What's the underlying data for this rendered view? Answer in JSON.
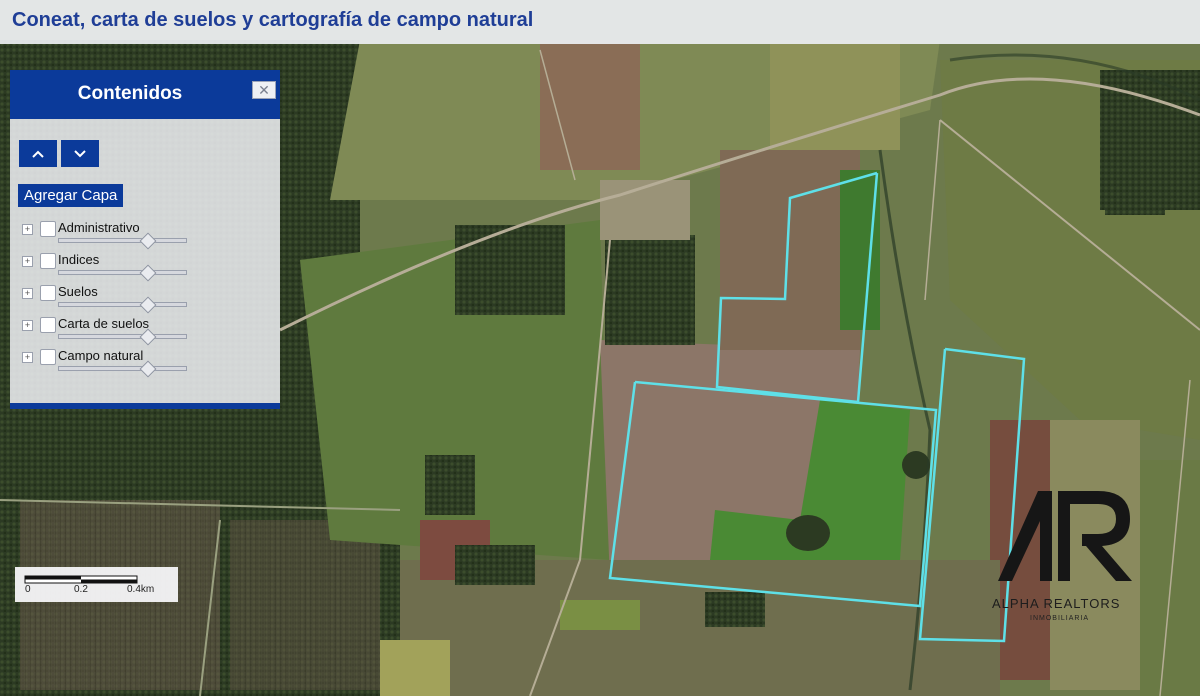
{
  "title": "Coneat, carta de suelos y cartografía de campo natural",
  "panel": {
    "title": "Contenidos",
    "close_symbol": "✕",
    "add_layer_label": "Agregar Capa",
    "layers": [
      {
        "label": "Administrativo",
        "opacity": 0.69
      },
      {
        "label": "Indices",
        "opacity": 0.69
      },
      {
        "label": "Suelos",
        "opacity": 0.69
      },
      {
        "label": "Carta de suelos",
        "opacity": 0.69
      },
      {
        "label": "Campo natural",
        "opacity": 0.69
      }
    ]
  },
  "scale": {
    "ticks": [
      "0",
      "0.2",
      "0.4km"
    ]
  },
  "logo": {
    "name": "ALPHA REALTORS",
    "sub": "INMOBILIARIA"
  },
  "colors": {
    "accent": "#0b3a9a",
    "title_text": "#1f3e96",
    "boundary": "#5ee0e8"
  },
  "icons": [
    "close-icon",
    "chevron-up-icon",
    "chevron-down-icon",
    "expand-plus-icon"
  ]
}
